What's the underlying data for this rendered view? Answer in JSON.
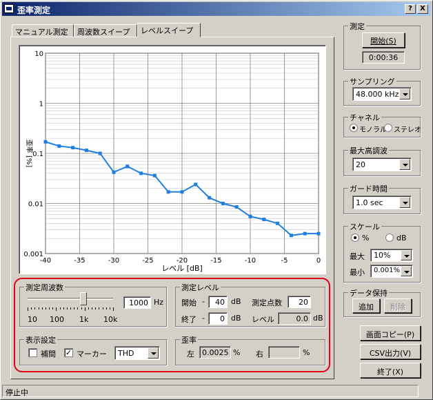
{
  "title": "歪率測定",
  "title_buttons": {
    "help": "?",
    "close": "X"
  },
  "tabs": [
    "マニュアル測定",
    "周波数スイープ",
    "レベルスイープ"
  ],
  "chart_data": {
    "type": "line",
    "xlabel": "レベル [dB]",
    "ylabel": "歪率 [%]",
    "xlim": [
      -40,
      0
    ],
    "ylim": [
      0.001,
      10
    ],
    "yscale": "log",
    "x_ticks": [
      "-40",
      "-35",
      "-30",
      "-25",
      "-20",
      "-15",
      "-10",
      "-5",
      "0"
    ],
    "y_ticks": [
      "10",
      "1",
      "0.1",
      "0.01",
      "0.001"
    ],
    "grid": true,
    "color": "#1e7fe0",
    "series": [
      {
        "x": [
          -40,
          -38,
          -36,
          -34,
          -32,
          -30,
          -28,
          -26,
          -24,
          -22,
          -20,
          -18,
          -16,
          -14,
          -12,
          -10,
          -8,
          -6,
          -4,
          -2,
          0
        ],
        "y": [
          0.17,
          0.14,
          0.13,
          0.115,
          0.1,
          0.042,
          0.055,
          0.04,
          0.036,
          0.017,
          0.017,
          0.024,
          0.013,
          0.01,
          0.0085,
          0.0055,
          0.0048,
          0.004,
          0.0023,
          0.0025,
          0.0025
        ]
      }
    ]
  },
  "freq_group": {
    "label": "測定周波数",
    "value": "1000",
    "unit": "Hz",
    "slider_position": 0.65,
    "scale": [
      "10",
      "100",
      "1k",
      "10k"
    ]
  },
  "level_group": {
    "label": "測定レベル",
    "start_label": "開始",
    "start_value": "40",
    "end_label": "終了",
    "end_value": "0",
    "db": "dB",
    "points_label": "測定点数",
    "points_value": "20",
    "level_label": "レベル",
    "level_value": "0.0",
    "dash": "-"
  },
  "display_group": {
    "label": "表示設定",
    "interp_label": "補間",
    "interp_checked": false,
    "marker_label": "マーカー",
    "marker_checked": true,
    "mode_value": "THD"
  },
  "distortion_group": {
    "label": "歪率",
    "left_label": "左",
    "left_value": "0.0025",
    "right_label": "右",
    "right_value": "",
    "unit": "%"
  },
  "measure": {
    "label": "測定",
    "start_button": "開始(S)",
    "time": "0:00:36"
  },
  "sampling": {
    "label": "サンプリング",
    "value": "48.000 kHz"
  },
  "channel": {
    "label": "チャネル",
    "mono": "モノラル",
    "stereo": "ステレオ",
    "selected": "mono"
  },
  "max_harmonic": {
    "label": "最大高調波",
    "value": "20"
  },
  "guard_time": {
    "label": "ガード時間",
    "value": "1.0 sec"
  },
  "scale": {
    "label": "スケール",
    "percent": "%",
    "db": "dB",
    "selected": "percent",
    "max_label": "最大",
    "max_value": "10%",
    "min_label": "最小",
    "min_value": "0.001%"
  },
  "data_hold": {
    "label": "データ保持",
    "add": "追加",
    "delete": "削除"
  },
  "buttons": {
    "copy": "画面コピー(P)",
    "csv": "CSV出力(V)",
    "exit": "終了(X)"
  },
  "status": "停止中"
}
